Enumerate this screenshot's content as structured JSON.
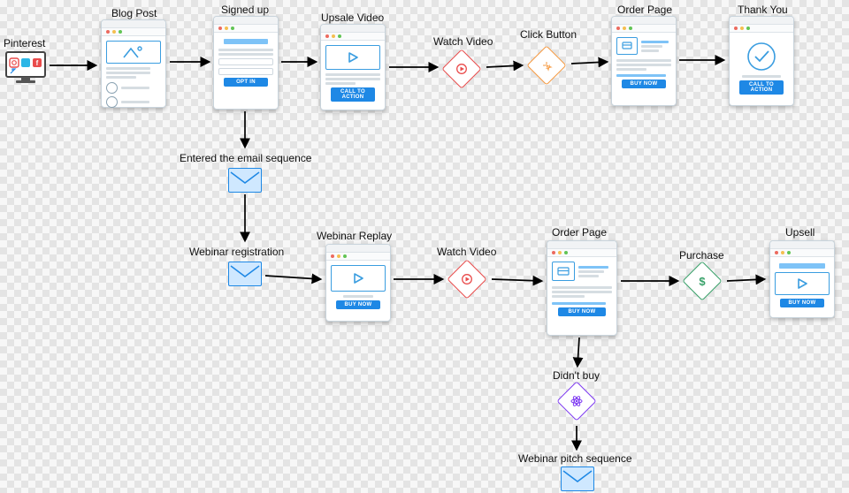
{
  "nodes": {
    "pinterest": {
      "label": "Pinterest"
    },
    "blog_post": {
      "label": "Blog Post"
    },
    "signed_up": {
      "label": "Signed up",
      "button": "OPT IN"
    },
    "upsale": {
      "label": "Upsale Video",
      "button": "CALL TO ACTION"
    },
    "watch1": {
      "label": "Watch Video"
    },
    "click_btn": {
      "label": "Click Button"
    },
    "order1": {
      "label": "Order Page",
      "button": "BUY NOW"
    },
    "thankyou": {
      "label": "Thank You",
      "button": "CALL TO ACTION"
    },
    "email_seq": {
      "label": "Entered the email sequence"
    },
    "web_reg": {
      "label": "Webinar registration"
    },
    "replay": {
      "label": "Webinar Replay",
      "button": "BUY NOW"
    },
    "watch2": {
      "label": "Watch Video"
    },
    "order2": {
      "label": "Order Page",
      "button": "BUY NOW"
    },
    "purchase": {
      "label": "Purchase"
    },
    "upsell": {
      "label": "Upsell",
      "button": "BUY NOW"
    },
    "didntbuy": {
      "label": "Didn't buy"
    },
    "pitch_seq": {
      "label": "Webinar pitch sequence"
    }
  },
  "colors": {
    "red": "#e94b4b",
    "orange": "#f6993f",
    "green": "#38a169",
    "purple": "#7e3af2",
    "blue": "#1e88e5"
  }
}
